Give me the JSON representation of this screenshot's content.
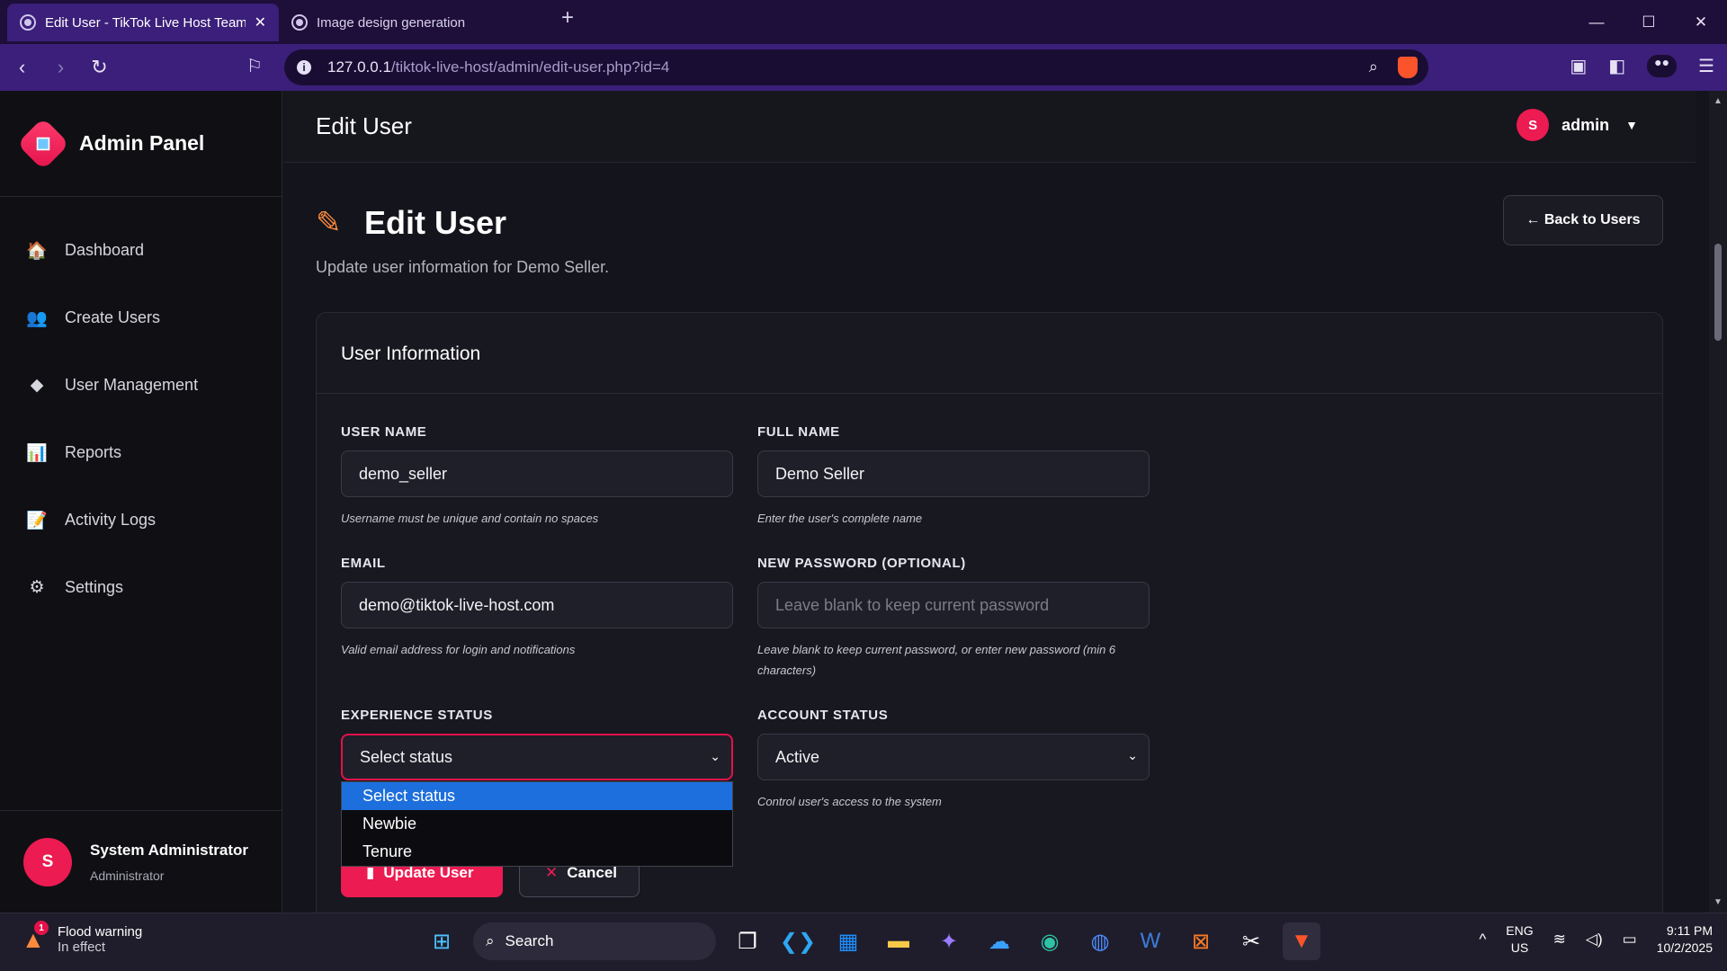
{
  "browser": {
    "tabs": [
      {
        "title": "Edit User - TikTok Live Host Team",
        "active": true
      },
      {
        "title": "Image design generation",
        "active": false
      }
    ],
    "url_host": "127.0.0.1",
    "url_path": "/tiktok-live-host/admin/edit-user.php?id=4"
  },
  "sidebar": {
    "brand": "Admin Panel",
    "items": [
      {
        "label": "Dashboard",
        "icon": "home-icon"
      },
      {
        "label": "Create Users",
        "icon": "users-icon"
      },
      {
        "label": "User Management",
        "icon": "diamond-icon"
      },
      {
        "label": "Reports",
        "icon": "chart-icon"
      },
      {
        "label": "Activity Logs",
        "icon": "document-icon"
      },
      {
        "label": "Settings",
        "icon": "gear-icon"
      }
    ],
    "user": {
      "initial": "S",
      "name": "System Administrator",
      "role": "Administrator"
    }
  },
  "topbar": {
    "title": "Edit User",
    "user_initial": "S",
    "username": "admin"
  },
  "main": {
    "heading": "Edit User",
    "subtitle": "Update user information for Demo Seller.",
    "back_button": "← Back to Users",
    "card_title": "User Information",
    "fields": {
      "username": {
        "label": "USER NAME",
        "value": "demo_seller",
        "hint": "Username must be unique and contain no spaces"
      },
      "fullname": {
        "label": "FULL NAME",
        "value": "Demo Seller",
        "hint": "Enter the user's complete name"
      },
      "email": {
        "label": "EMAIL",
        "value": "demo@tiktok-live-host.com",
        "hint": "Valid email address for login and notifications"
      },
      "password": {
        "label": "NEW PASSWORD (OPTIONAL)",
        "placeholder": "Leave blank to keep current password",
        "hint": "Leave blank to keep current password, or enter new password (min 6 characters)"
      },
      "experience": {
        "label": "EXPERIENCE STATUS",
        "value": "Select status",
        "options": [
          "Select status",
          "Newbie",
          "Tenure"
        ]
      },
      "account": {
        "label": "ACCOUNT STATUS",
        "value": "Active",
        "hint": "Control user's access to the system"
      }
    },
    "update_button": "Update User",
    "cancel_button": "Cancel"
  },
  "taskbar": {
    "weather_title": "Flood warning",
    "weather_sub": "In effect",
    "weather_badge": "1",
    "search": "Search",
    "lang_top": "ENG",
    "lang_bottom": "US",
    "time": "9:11 PM",
    "date": "10/2/2025"
  }
}
